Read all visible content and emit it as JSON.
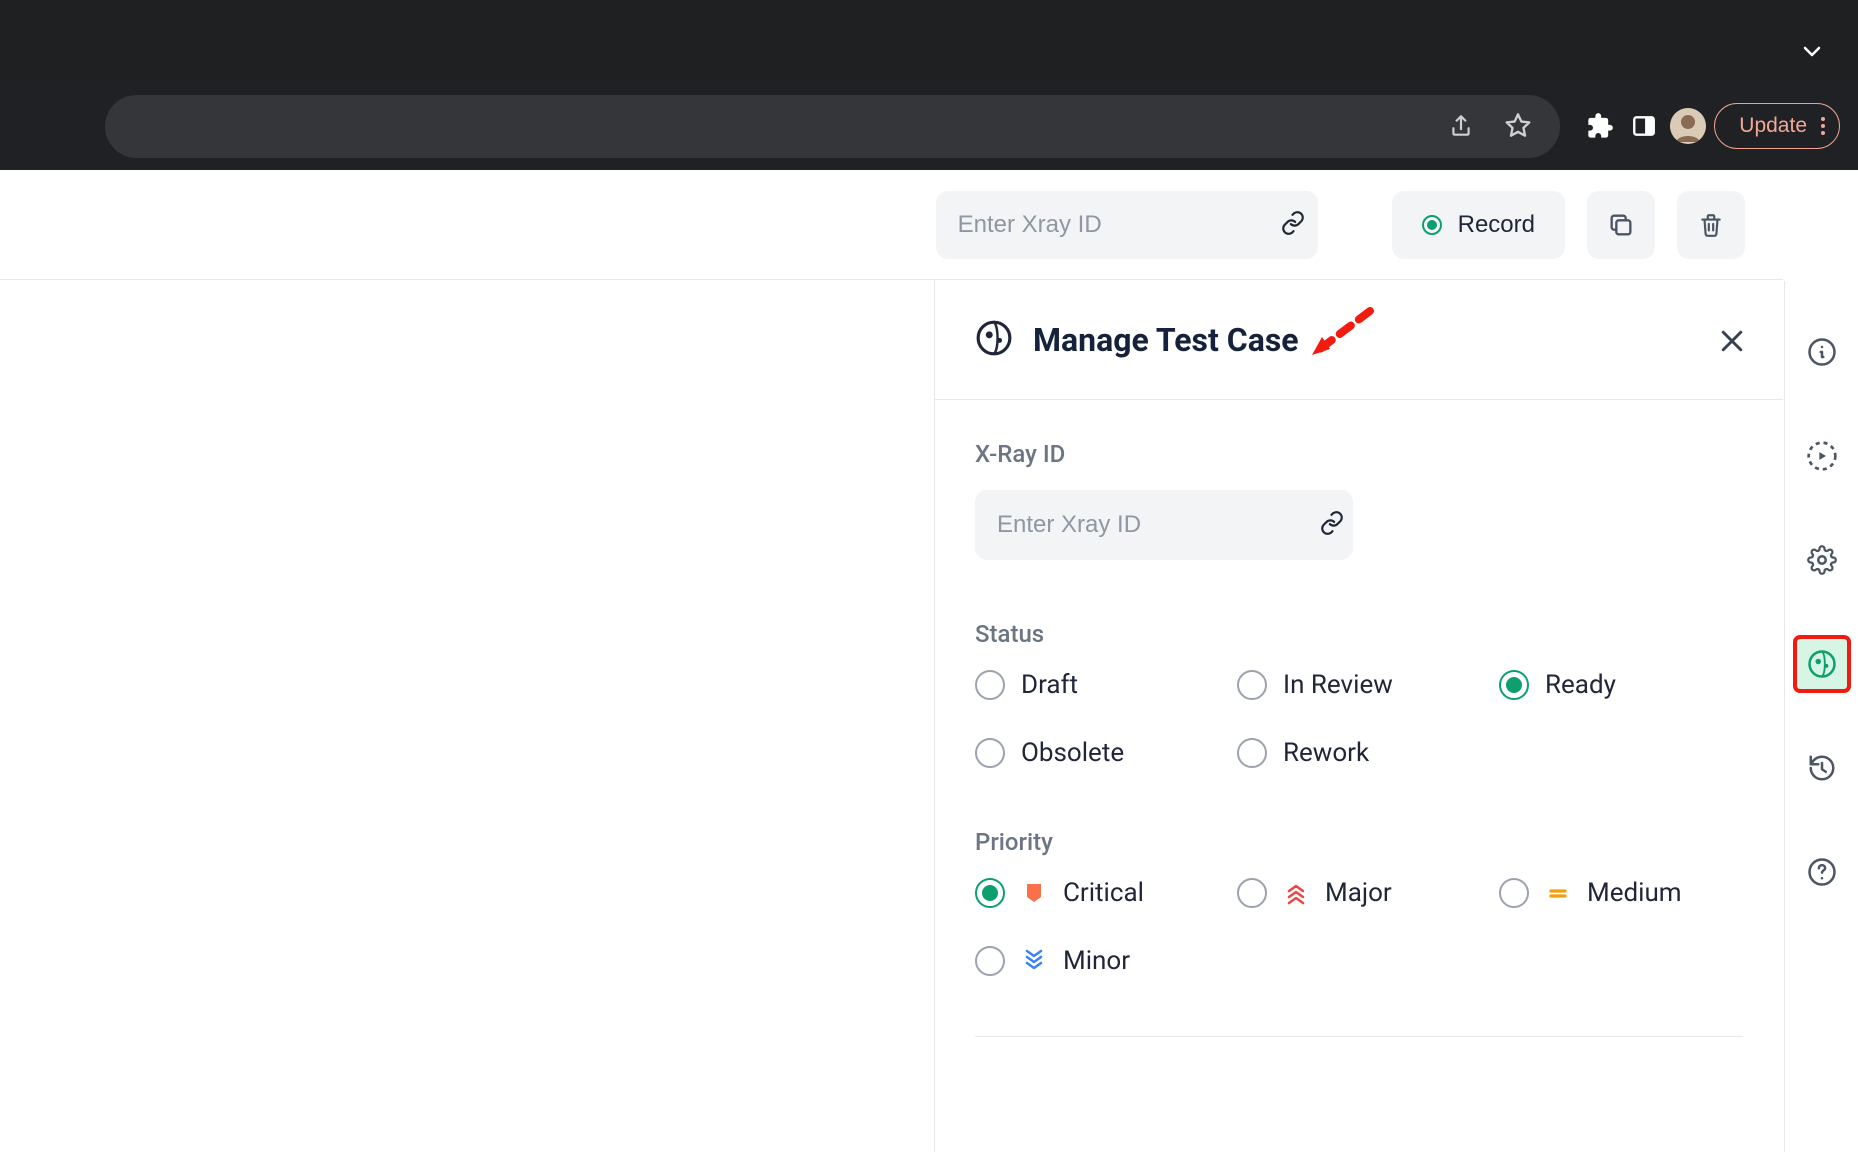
{
  "chrome": {
    "update_label": "Update"
  },
  "toolbar": {
    "xray_placeholder": "Enter Xray ID",
    "record_label": "Record"
  },
  "panel": {
    "title": "Manage Test Case",
    "xray_label": "X-Ray ID",
    "xray_placeholder": "Enter Xray ID",
    "status_label": "Status",
    "status_options": {
      "draft": "Draft",
      "in_review": "In Review",
      "ready": "Ready",
      "obsolete": "Obsolete",
      "rework": "Rework"
    },
    "priority_label": "Priority",
    "priority_options": {
      "critical": "Critical",
      "major": "Major",
      "medium": "Medium",
      "minor": "Minor"
    }
  }
}
